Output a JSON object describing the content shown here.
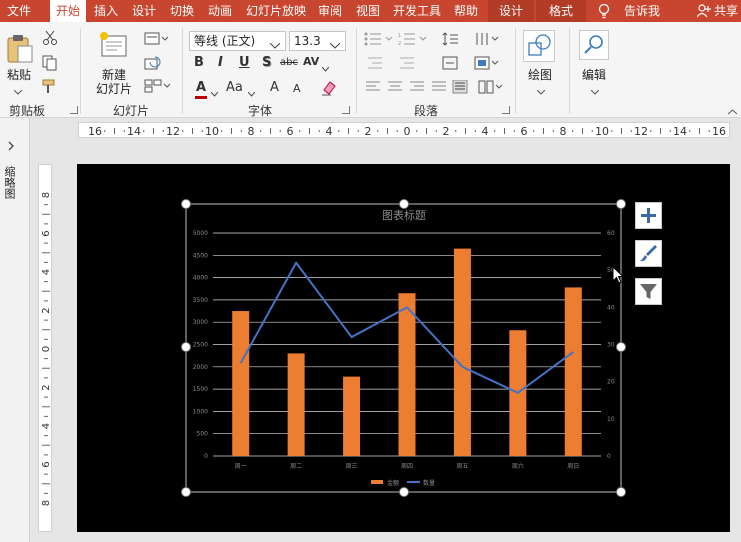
{
  "ribbon_tabs": {
    "file": "文件",
    "home": "开始",
    "insert": "插入",
    "design": "设计",
    "transitions": "切换",
    "animations": "动画",
    "slideshow": "幻灯片放映",
    "review": "审阅",
    "view": "视图",
    "developer": "开发工具",
    "help": "帮助",
    "chart_design": "设计",
    "chart_format": "格式",
    "tell_me": "告诉我",
    "share": "共享"
  },
  "clipboard": {
    "paste": "粘贴",
    "group": "剪贴板"
  },
  "slides": {
    "new_slide_line1": "新建",
    "new_slide_line2": "幻灯片",
    "group": "幻灯片"
  },
  "font": {
    "name": "等线 (正文)",
    "size": "13.3",
    "group": "字体",
    "bold": "B",
    "italic": "I",
    "underline": "U",
    "shadow": "S",
    "strike": "abc",
    "spacing": "AV",
    "color": "A",
    "case": "Aa",
    "grow": "A",
    "shrink": "A"
  },
  "paragraph": {
    "group": "段落"
  },
  "drawing": {
    "label": "绘图"
  },
  "editing": {
    "label": "编辑"
  },
  "thumbnails": {
    "label": "缩略图"
  },
  "rulers": {
    "horizontal_ticks": [
      "16",
      "14",
      "12",
      "10",
      "8",
      "6",
      "4",
      "2",
      "0",
      "2",
      "4",
      "6",
      "8",
      "10",
      "12",
      "14",
      "16"
    ],
    "vertical_ticks": [
      "8",
      "6",
      "4",
      "2",
      "0",
      "2",
      "4",
      "6",
      "8"
    ]
  },
  "colors": {
    "accent": "#c8462f",
    "bar": "#ed7d31",
    "line": "#4472c4",
    "slide_bg": "#000000",
    "grid": "#d9d9d9",
    "axis_text": "#8c8c8c"
  },
  "chart_data": {
    "type": "bar",
    "title": "图表标题",
    "categories": [
      "周一",
      "周二",
      "周三",
      "周四",
      "周五",
      "周六",
      "周日"
    ],
    "series": [
      {
        "name": "金额",
        "type": "bar",
        "axis": "left",
        "values": [
          3250,
          2300,
          1780,
          3650,
          4650,
          2820,
          3780
        ]
      },
      {
        "name": "数量",
        "type": "line",
        "axis": "right",
        "values": [
          25,
          52,
          32,
          40,
          24,
          17,
          28
        ]
      }
    ],
    "y_left": {
      "min": 0,
      "max": 5000,
      "ticks": [
        "0",
        "500",
        "1000",
        "1500",
        "2000",
        "2500",
        "3000",
        "3500",
        "4000",
        "4500",
        "5000"
      ]
    },
    "y_right": {
      "min": 0,
      "max": 60,
      "ticks": [
        "0",
        "10",
        "20",
        "30",
        "40",
        "50",
        "60"
      ]
    },
    "grid": true,
    "legend_position": "bottom"
  }
}
